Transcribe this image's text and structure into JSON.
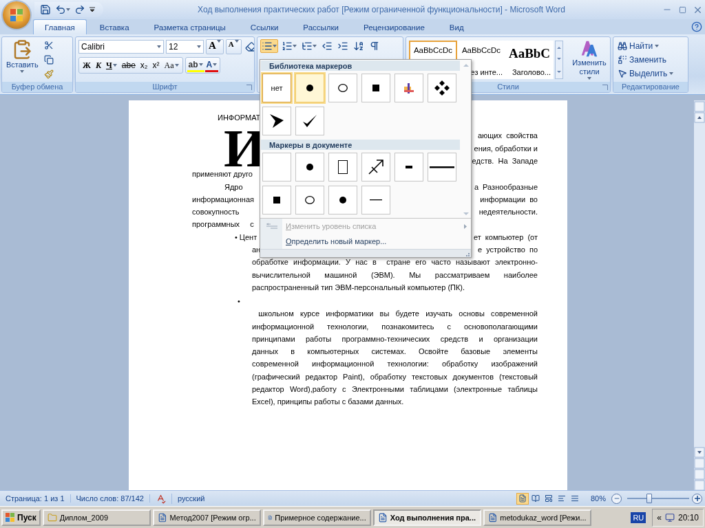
{
  "window": {
    "title": "Ход выполнения практических работ [Режим ограниченной функциональности] - Microsoft Word"
  },
  "tabs": [
    {
      "label": "Главная",
      "selected": true
    },
    {
      "label": "Вставка",
      "selected": false
    },
    {
      "label": "Разметка страницы",
      "selected": false
    },
    {
      "label": "Ссылки",
      "selected": false
    },
    {
      "label": "Рассылки",
      "selected": false
    },
    {
      "label": "Рецензирование",
      "selected": false
    },
    {
      "label": "Вид",
      "selected": false
    }
  ],
  "clipboard": {
    "paste_label": "Вставить",
    "group_label": "Буфер обмена"
  },
  "font": {
    "name": "Calibri",
    "size": "12",
    "grow_label": "A",
    "shrink_label": "A",
    "group_label": "Шрифт",
    "buttons": [
      {
        "label": "Ж",
        "kind": "bold",
        "dropdown": false
      },
      {
        "label": "К",
        "kind": "italic",
        "dropdown": false
      },
      {
        "label": "Ч",
        "kind": "underline",
        "dropdown": true
      },
      {
        "label": "abe",
        "kind": "strike",
        "dropdown": false
      },
      {
        "label": "x₂",
        "kind": "plain",
        "dropdown": false
      },
      {
        "label": "x²",
        "kind": "plain",
        "dropdown": false
      },
      {
        "label": "Aa",
        "kind": "serif",
        "dropdown": true
      }
    ],
    "highlight_label": "ab",
    "color_label": "A"
  },
  "paragraph": {
    "bullets_active": true
  },
  "styles": {
    "group_label": "Стили",
    "change_label": "Изменить стили",
    "items": [
      {
        "preview": "AaBbCcDc",
        "kind": "normal",
        "selected": true
      },
      {
        "preview": "AaBbCcDc",
        "label": "ез инте...",
        "kind": "normal",
        "selected": false
      },
      {
        "preview": "AaBbC",
        "label": "Заголово...",
        "kind": "heading",
        "selected": false
      }
    ]
  },
  "editing": {
    "group_label": "Редактирование",
    "items": [
      {
        "label": "Найти",
        "kind": "find",
        "dropdown": true
      },
      {
        "label": "Заменить",
        "kind": "replace",
        "dropdown": false
      },
      {
        "label": "Выделить",
        "kind": "select",
        "dropdown": true
      }
    ]
  },
  "bullet_menu": {
    "sections": [
      {
        "title": "Библиотека маркеров",
        "items": [
          {
            "kind": "text",
            "label": "нет",
            "selected": true,
            "hovered": false
          },
          {
            "kind": "dot",
            "selected": false,
            "hovered": true
          },
          {
            "kind": "circle",
            "selected": false,
            "hovered": false
          },
          {
            "kind": "square",
            "selected": false,
            "hovered": false
          },
          {
            "kind": "colorful",
            "selected": false,
            "hovered": false
          },
          {
            "kind": "diamonds",
            "selected": false,
            "hovered": false
          },
          {
            "kind": "arrowhead",
            "selected": false,
            "hovered": false
          },
          {
            "kind": "check",
            "selected": false,
            "hovered": false
          }
        ]
      },
      {
        "title": "Маркеры в документе",
        "items": [
          {
            "kind": "empty",
            "selected": false,
            "hovered": false
          },
          {
            "kind": "dot",
            "selected": false,
            "hovered": false
          },
          {
            "kind": "rect",
            "selected": false,
            "hovered": false
          },
          {
            "kind": "sagittarius",
            "selected": false,
            "hovered": false
          },
          {
            "kind": "dash",
            "selected": false,
            "hovered": false
          },
          {
            "kind": "long-line",
            "selected": false,
            "hovered": false
          },
          {
            "kind": "square",
            "selected": false,
            "hovered": false
          },
          {
            "kind": "circle",
            "selected": false,
            "hovered": false
          },
          {
            "kind": "dot",
            "selected": false,
            "hovered": false
          },
          {
            "kind": "line",
            "selected": false,
            "hovered": false
          }
        ]
      }
    ],
    "commands": [
      {
        "label": "Изменить уровень списка",
        "disabled": true,
        "submenu": true
      },
      {
        "label": "Определить новый маркер...",
        "disabled": false,
        "submenu": false
      }
    ]
  },
  "document": {
    "heading": "ИНФОРМАТ",
    "drop_cap": {
      "letter": "И",
      "right": [
        "ающих  свойства",
        "ения, обработки и",
        "едств.  На  Западе"
      ]
    },
    "covered_lines": [
      {
        "kind": "body",
        "left": "применяют друго"
      },
      {
        "kind": "first-line",
        "left": "Ядро",
        "right": "а  Разнообразные"
      },
      {
        "kind": "body",
        "left": "информационная",
        "right": "информации  во"
      },
      {
        "kind": "body",
        "left": "совокупность",
        "right": "недеятельности."
      },
      {
        "kind": "body",
        "left": "программных     с"
      },
      {
        "kind": "bullet",
        "marker": "•",
        "left": "Цент",
        "right": "ет  компьютер  (от"
      },
      {
        "kind": "continuation",
        "left": "ан",
        "right": "е  устройство  по"
      }
    ],
    "blocks": [
      {
        "lines": [
          "обработке информации. У нас в  стране его часто называют электронно-",
          "вычислительной машиной (ЭВМ). Мы рассматриваем наиболее",
          "распространенный тип ЭВМ-персональный компьютер (ПК)."
        ]
      },
      {
        "marker": "•",
        "lines": [
          " школьном курсе информатики вы будете изучать основы современной",
          "информационной технологии, познакомитесь с основополагающими",
          "принципами работы программно-технических средств и организации",
          "данных в компьютерных системах. Освойте базовые элементы",
          "современной информационной технологии: обработку изображений",
          "(графический редактор Paint), обработку текстовых документов (текстовый",
          "редактор Word),работу с Электронными таблицами (электронные таблицы",
          "Excel), принципы работы с базами данных."
        ]
      }
    ]
  },
  "status_bar": {
    "page": "Страница: 1 из 1",
    "words": "Число слов: 87/142",
    "language": "русский",
    "views": [
      {
        "selected": true
      },
      {
        "selected": false
      },
      {
        "selected": false
      },
      {
        "selected": false
      },
      {
        "selected": false
      }
    ],
    "zoom": "80%",
    "zoom_slider": {
      "level": 0.36
    }
  },
  "taskbar": {
    "start": "Пуск",
    "tasks": [
      {
        "label": "Диплом_2009",
        "kind": "folder",
        "selected": false
      },
      {
        "label": "Метод2007 [Режим огр...",
        "kind": "doc",
        "selected": false
      },
      {
        "label": "Примерное содержание...",
        "kind": "doc",
        "selected": false
      },
      {
        "label": "Ход выполнения пра...",
        "kind": "doc",
        "selected": true
      },
      {
        "label": "metodukaz_word [Режи...",
        "kind": "doc",
        "selected": false
      }
    ],
    "language": "RU",
    "tray_toggle": "«",
    "time": "20:10"
  }
}
